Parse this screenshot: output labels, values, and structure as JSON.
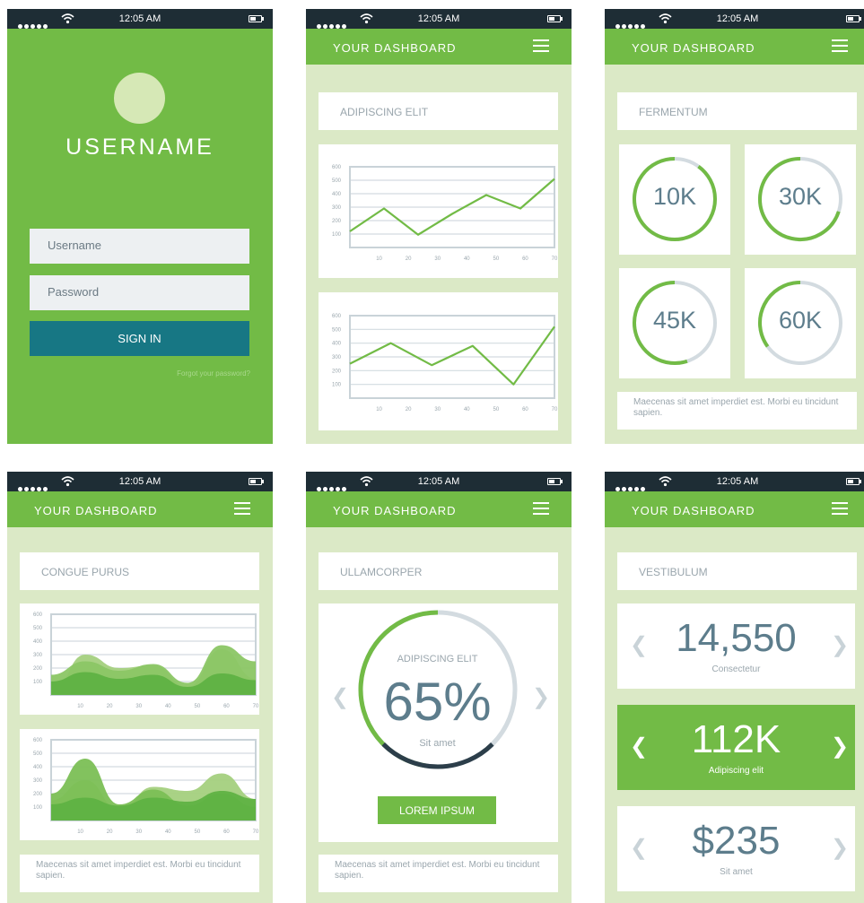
{
  "status_bar": {
    "time": "12:05 AM"
  },
  "colors": {
    "green": "#72bb46",
    "light_green": "#dbe9c6",
    "dark": "#1e2d35",
    "teal": "#177784",
    "slate": "#5d7d8c",
    "grey": "#c9d3d8",
    "dark_ring": "#2c3e4a"
  },
  "app_title": "YOUR DASHBOARD",
  "login": {
    "heading": "USERNAME",
    "username_placeholder": "Username",
    "password_placeholder": "Password",
    "sign_in": "SIGN IN",
    "forgot": "Forgot your password?"
  },
  "screen_line": {
    "title": "ADIPISCING ELIT",
    "chart_data": [
      {
        "type": "line",
        "x": [
          0,
          10,
          20,
          30,
          40,
          50,
          60,
          70
        ],
        "xticks": [
          10,
          20,
          30,
          40,
          50,
          60,
          70
        ],
        "yticks": [
          100,
          200,
          300,
          400,
          500,
          600
        ],
        "ylim": [
          0,
          600
        ],
        "values": [
          120,
          290,
          95,
          250,
          390,
          290,
          510
        ]
      },
      {
        "type": "line",
        "x": [
          0,
          10,
          20,
          30,
          40,
          50,
          60,
          70
        ],
        "xticks": [
          10,
          20,
          30,
          40,
          50,
          60,
          70
        ],
        "yticks": [
          100,
          200,
          300,
          400,
          500,
          600
        ],
        "ylim": [
          0,
          600
        ],
        "values": [
          250,
          400,
          240,
          380,
          100,
          520
        ]
      }
    ]
  },
  "screen_rings": {
    "title": "FERMENTUM",
    "rings": [
      {
        "label": "10K",
        "fraction": 0.9
      },
      {
        "label": "30K",
        "fraction": 0.7
      },
      {
        "label": "45K",
        "fraction": 0.55
      },
      {
        "label": "60K",
        "fraction": 0.35
      }
    ],
    "note": "Maecenas sit amet imperdiet est. Morbi eu tincidunt sapien."
  },
  "screen_area": {
    "title": "CONGUE PURUS",
    "chart_data": [
      {
        "type": "area",
        "xticks": [
          10,
          20,
          30,
          40,
          50,
          60,
          70
        ],
        "yticks": [
          100,
          200,
          300,
          400,
          500,
          600
        ],
        "ylim": [
          0,
          600
        ],
        "series": [
          {
            "values": [
              20,
              300,
              200,
              220,
              60,
              340,
              120
            ],
            "color": "#a4d07e"
          },
          {
            "values": [
              150,
              250,
              180,
              230,
              90,
              370,
              250
            ],
            "color": "#8bc665"
          },
          {
            "values": [
              100,
              170,
              120,
              150,
              60,
              160,
              110
            ],
            "color": "#5fb243"
          }
        ]
      },
      {
        "type": "area",
        "xticks": [
          10,
          20,
          30,
          40,
          50,
          60,
          70
        ],
        "yticks": [
          100,
          200,
          300,
          400,
          500,
          600
        ],
        "ylim": [
          0,
          600
        ],
        "series": [
          {
            "values": [
              150,
              300,
              80,
              250,
              220,
              350,
              160
            ],
            "color": "#a4d07e"
          },
          {
            "values": [
              200,
              460,
              120,
              230,
              110,
              200,
              100
            ],
            "color": "#7bbf55"
          },
          {
            "values": [
              120,
              170,
              110,
              170,
              140,
              220,
              160
            ],
            "color": "#5fb243"
          }
        ]
      }
    ],
    "note": "Maecenas sit amet imperdiet est. Morbi eu tincidunt sapien."
  },
  "screen_gauge": {
    "title": "ULLAMCORPER",
    "gauge_title": "ADIPISCING ELIT",
    "value": "65%",
    "fraction": 0.65,
    "subtitle": "Sit amet",
    "button": "LOREM IPSUM",
    "note": "Maecenas sit amet imperdiet est. Morbi eu tincidunt sapien."
  },
  "screen_stats": {
    "title": "VESTIBULUM",
    "stats": [
      {
        "value": "14,550",
        "label": "Consectetur"
      },
      {
        "value": "112K",
        "label": "Adipiscing elit"
      },
      {
        "value": "$235",
        "label": "Sit amet"
      }
    ]
  },
  "icons": {
    "left": "chevron-left-icon",
    "right": "chevron-right-icon",
    "menu": "hamburger-menu-icon",
    "wifi": "wifi-icon",
    "battery": "battery-icon"
  }
}
